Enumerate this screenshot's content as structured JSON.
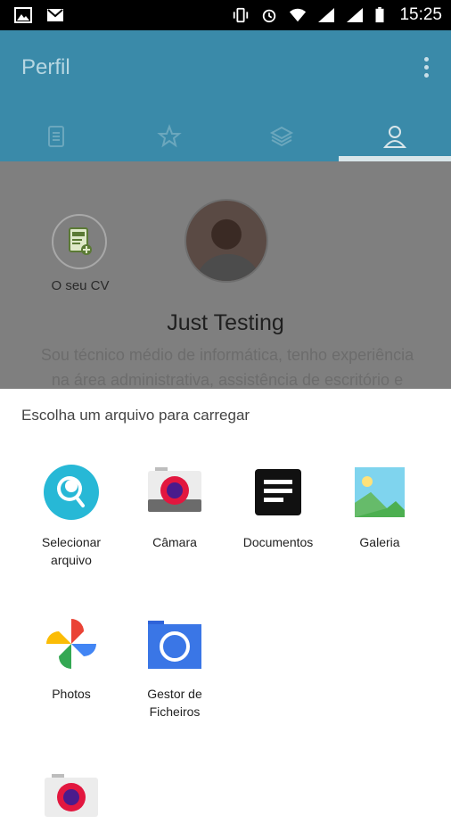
{
  "status_bar": {
    "time": "15:25"
  },
  "app_bar": {
    "title": "Perfil"
  },
  "tabs": [
    "document-tab",
    "favorites-tab",
    "layers-tab",
    "profile-tab"
  ],
  "profile": {
    "cv_label": "O seu CV",
    "name": "Just Testing",
    "description_line1": "Sou técnico médio de informática, tenho experiência",
    "description_line2": "na área administrativa, assistência de escritório e"
  },
  "sheet": {
    "title": "Escolha um arquivo para carregar",
    "apps": [
      {
        "label": "Selecionar arquivo",
        "icon": "file-picker-icon"
      },
      {
        "label": "Câmara",
        "icon": "camera-icon"
      },
      {
        "label": "Documentos",
        "icon": "documents-icon"
      },
      {
        "label": "Galeria",
        "icon": "gallery-icon"
      },
      {
        "label": "Photos",
        "icon": "photos-icon"
      },
      {
        "label": "Gestor de Ficheiros",
        "icon": "file-manager-icon"
      }
    ]
  },
  "colors": {
    "appbar": "#3a8aa9",
    "dim_overlay": "#7f7f7f",
    "camera_red": "#e2173f"
  }
}
